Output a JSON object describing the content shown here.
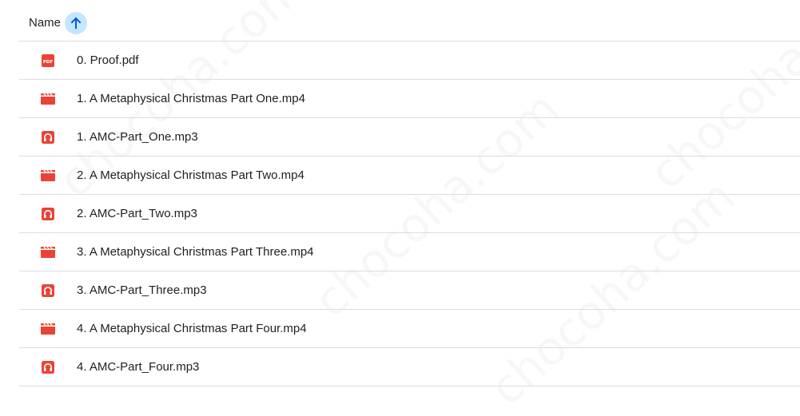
{
  "header": {
    "column_name": "Name",
    "sort_direction": "ascending",
    "sort_icon": "arrow-up-icon"
  },
  "files": [
    {
      "name": "0. Proof.pdf",
      "type": "pdf",
      "icon": "pdf-icon"
    },
    {
      "name": "1. A Metaphysical Christmas Part One.mp4",
      "type": "video",
      "icon": "video-icon"
    },
    {
      "name": "1. AMC-Part_One.mp3",
      "type": "audio",
      "icon": "audio-icon"
    },
    {
      "name": "2. A Metaphysical Christmas Part Two.mp4",
      "type": "video",
      "icon": "video-icon"
    },
    {
      "name": "2. AMC-Part_Two.mp3",
      "type": "audio",
      "icon": "audio-icon"
    },
    {
      "name": "3. A Metaphysical Christmas Part Three.mp4",
      "type": "video",
      "icon": "video-icon"
    },
    {
      "name": "3. AMC-Part_Three.mp3",
      "type": "audio",
      "icon": "audio-icon"
    },
    {
      "name": "4. A Metaphysical Christmas Part Four.mp4",
      "type": "video",
      "icon": "video-icon"
    },
    {
      "name": "4. AMC-Part_Four.mp3",
      "type": "audio",
      "icon": "audio-icon"
    }
  ],
  "watermark": {
    "text": "chocoha.com"
  },
  "colors": {
    "file_icon_red": "#ea4335",
    "sort_highlight": "#c2e7ff",
    "sort_arrow": "#0b57d0",
    "divider": "#dadce0"
  }
}
